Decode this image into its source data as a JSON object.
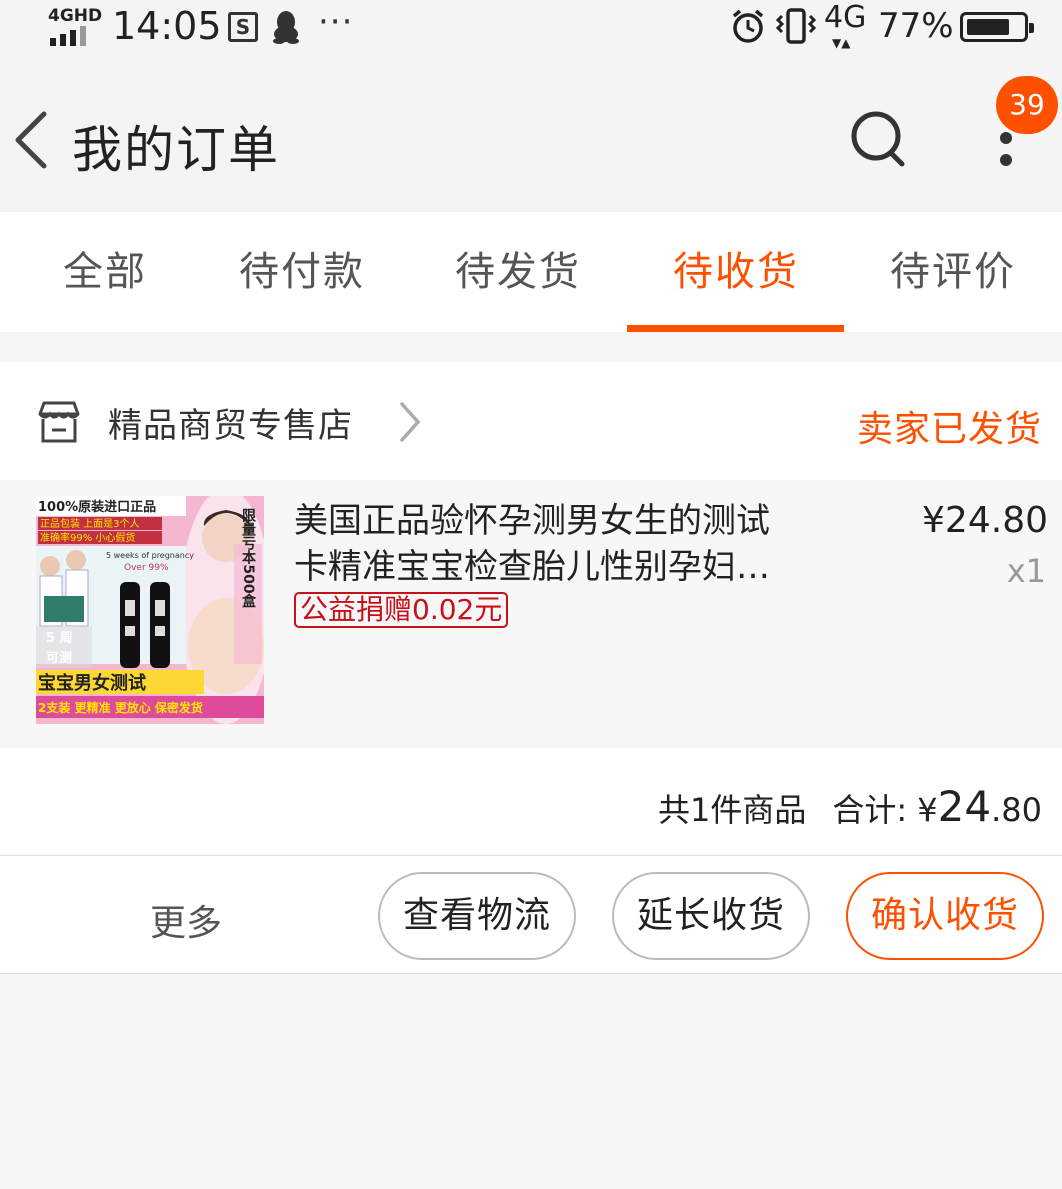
{
  "status_bar": {
    "network_label": "4GHD",
    "time": "14:05",
    "mobile_data": "4G",
    "battery_percent": "77%",
    "battery_level": 0.77,
    "icons": [
      "s-app-icon",
      "qq-icon",
      "more-dots-icon",
      "alarm-icon",
      "vibrate-icon",
      "battery-icon"
    ]
  },
  "header": {
    "title": "我的订单",
    "badge_count": "39",
    "icons": [
      "back-icon",
      "search-icon",
      "more-vertical-icon"
    ]
  },
  "tabs": [
    {
      "label": "全部",
      "active": false
    },
    {
      "label": "待付款",
      "active": false
    },
    {
      "label": "待发货",
      "active": false
    },
    {
      "label": "待收货",
      "active": true
    },
    {
      "label": "待评价",
      "active": false
    }
  ],
  "order": {
    "shop_name": "精品商贸专售店",
    "status": "卖家已发货",
    "item": {
      "title_line1": "美国正品验怀孕测男女生的测试",
      "title_line2": "卡精准宝宝检查胎儿性别孕妇…",
      "charity_tag": "公益捐赠0.02元",
      "price": "¥24.80",
      "quantity": "x1",
      "thumbnail_text": {
        "top_banner": "100%原装进口正品",
        "line_a": "正品包装 上面是3个人",
        "line_b": "准确率99% 小心假货",
        "weeks": "5 weeks of pregnancy",
        "over": "Over 99%",
        "limit": "限量亏本500盒",
        "five_weeks": "5 周",
        "testable": "可测",
        "main_caption": "宝宝男女测试",
        "bottom_caption": "2支装 更精准 更放心 保密发货"
      }
    },
    "summary": {
      "count_text": "共1件商品",
      "total_label": "合计:",
      "currency": "¥",
      "total_int": "24",
      "total_dec": ".80"
    },
    "actions": {
      "more": "更多",
      "view_logistics": "查看物流",
      "extend_receipt": "延长收货",
      "confirm_receipt": "确认收货"
    }
  },
  "colors": {
    "accent": "#ff5000",
    "charity": "#c8101a",
    "background": "#f5f5f5"
  }
}
